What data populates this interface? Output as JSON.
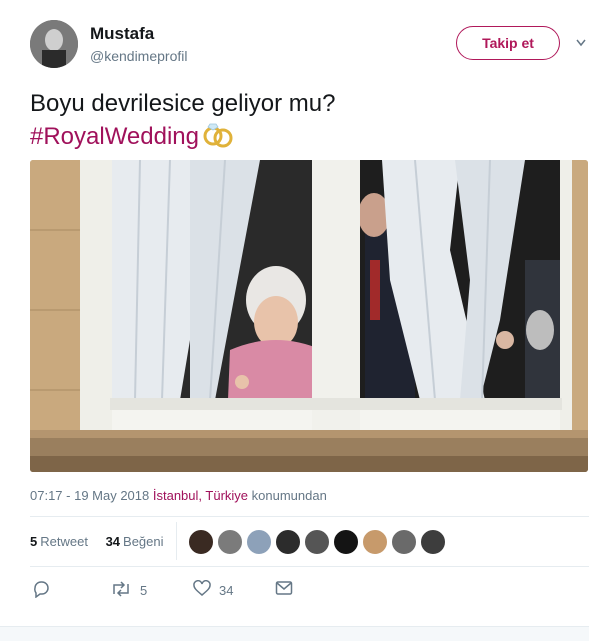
{
  "user": {
    "name": "Mustafa",
    "handle": "@kendimeprofil"
  },
  "follow_label": "Takip et",
  "tweet": {
    "text": "Boyu devrilesice geliyor mu?",
    "hashtag": "#RoyalWedding"
  },
  "meta": {
    "time": "07:17 - 19 May 2018",
    "location": "İstanbul, Türkiye",
    "location_suffix": "konumundan"
  },
  "stats": {
    "retweet_count": "5",
    "retweet_label": "Retweet",
    "like_count": "34",
    "like_label": "Beğeni"
  },
  "liker_avatars": [
    "#3a2a22",
    "#7b7b7b",
    "#8da1b9",
    "#2c2c2c",
    "#555555",
    "#141414",
    "#c79a6b",
    "#6a6a6a",
    "#3d3d3d"
  ],
  "actions": {
    "reply_count": "",
    "retweet_count": "5",
    "like_count": "34"
  },
  "colors": {
    "accent": "#a0115b",
    "muted": "#657786"
  }
}
